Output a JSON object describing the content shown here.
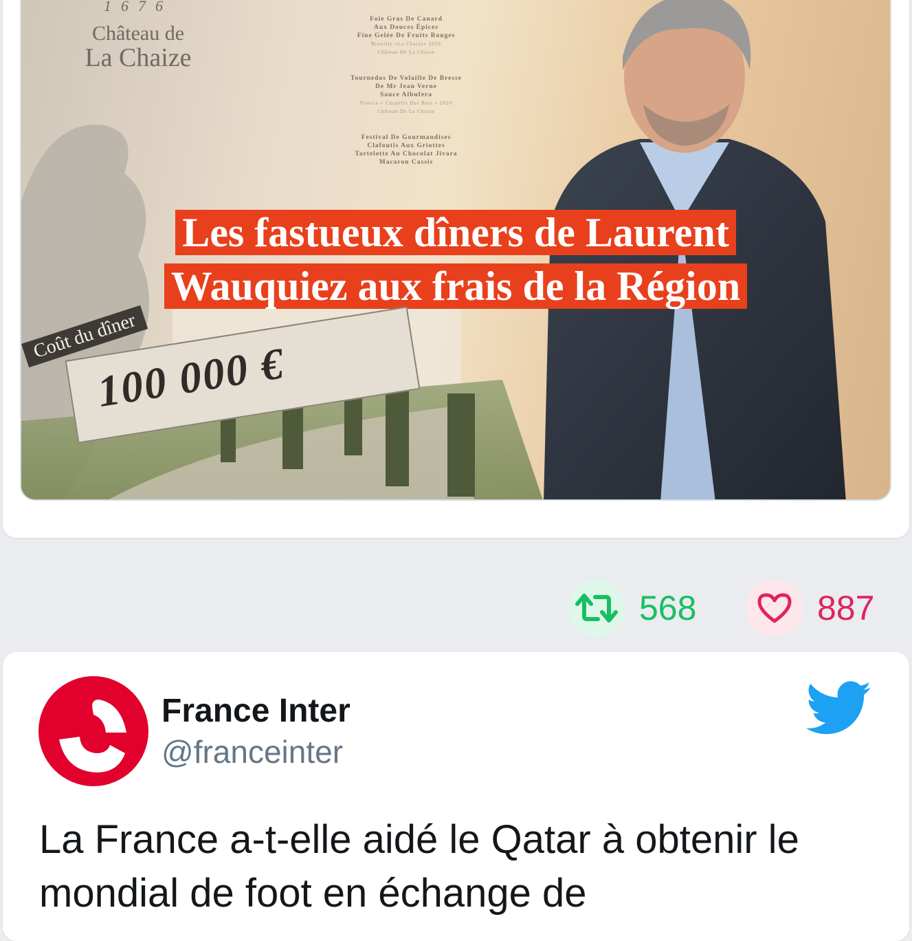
{
  "post1": {
    "image": {
      "chateau_year": "1676",
      "chateau_line1": "Château de",
      "chateau_line2": "La Chaize",
      "menu": [
        {
          "text": "Foie Gras De Canard",
          "kind": "course"
        },
        {
          "text": "Aux Douces Épices",
          "kind": "course"
        },
        {
          "text": "Fine Gelée De Fruits Rouges",
          "kind": "course"
        },
        {
          "text": "Brouilly «La Chaize» 2020",
          "kind": "wine"
        },
        {
          "text": "Château De La Chaize",
          "kind": "wine"
        },
        {
          "text": "",
          "kind": "gap"
        },
        {
          "text": "Tournedos De Volaille De Bresse",
          "kind": "course"
        },
        {
          "text": "De Mr Jean Verne",
          "kind": "course"
        },
        {
          "text": "Sauce Albufera",
          "kind": "course"
        },
        {
          "text": "Fleurie « Chapelle Des Bois » 2020",
          "kind": "wine"
        },
        {
          "text": "Château De La Chaize",
          "kind": "wine"
        },
        {
          "text": "",
          "kind": "gap"
        },
        {
          "text": "Festival De Gourmandises",
          "kind": "course"
        },
        {
          "text": "Clafoutis Aux Griottes",
          "kind": "course"
        },
        {
          "text": "Tartelette Au Chocolat Jivara",
          "kind": "course"
        },
        {
          "text": "Macaron Cassis",
          "kind": "course"
        }
      ],
      "headline_line1": "Les fastueux dîners de Laurent",
      "headline_line2": "Wauquiez aux frais de la Région",
      "cost_label": "Coût du dîner",
      "cost_value": "100 000 €",
      "accent": "#e8401c"
    },
    "retweets": "568",
    "likes": "887",
    "retweet_color": "#17bf63",
    "like_color": "#e0245e"
  },
  "post2": {
    "author_name": "France Inter",
    "author_handle": "@franceinter",
    "avatar_color": "#e2002d",
    "platform_icon": "twitter-bird-icon",
    "text": "La France a-t-elle aidé le Qatar à obtenir le mondial de foot en échange de"
  }
}
